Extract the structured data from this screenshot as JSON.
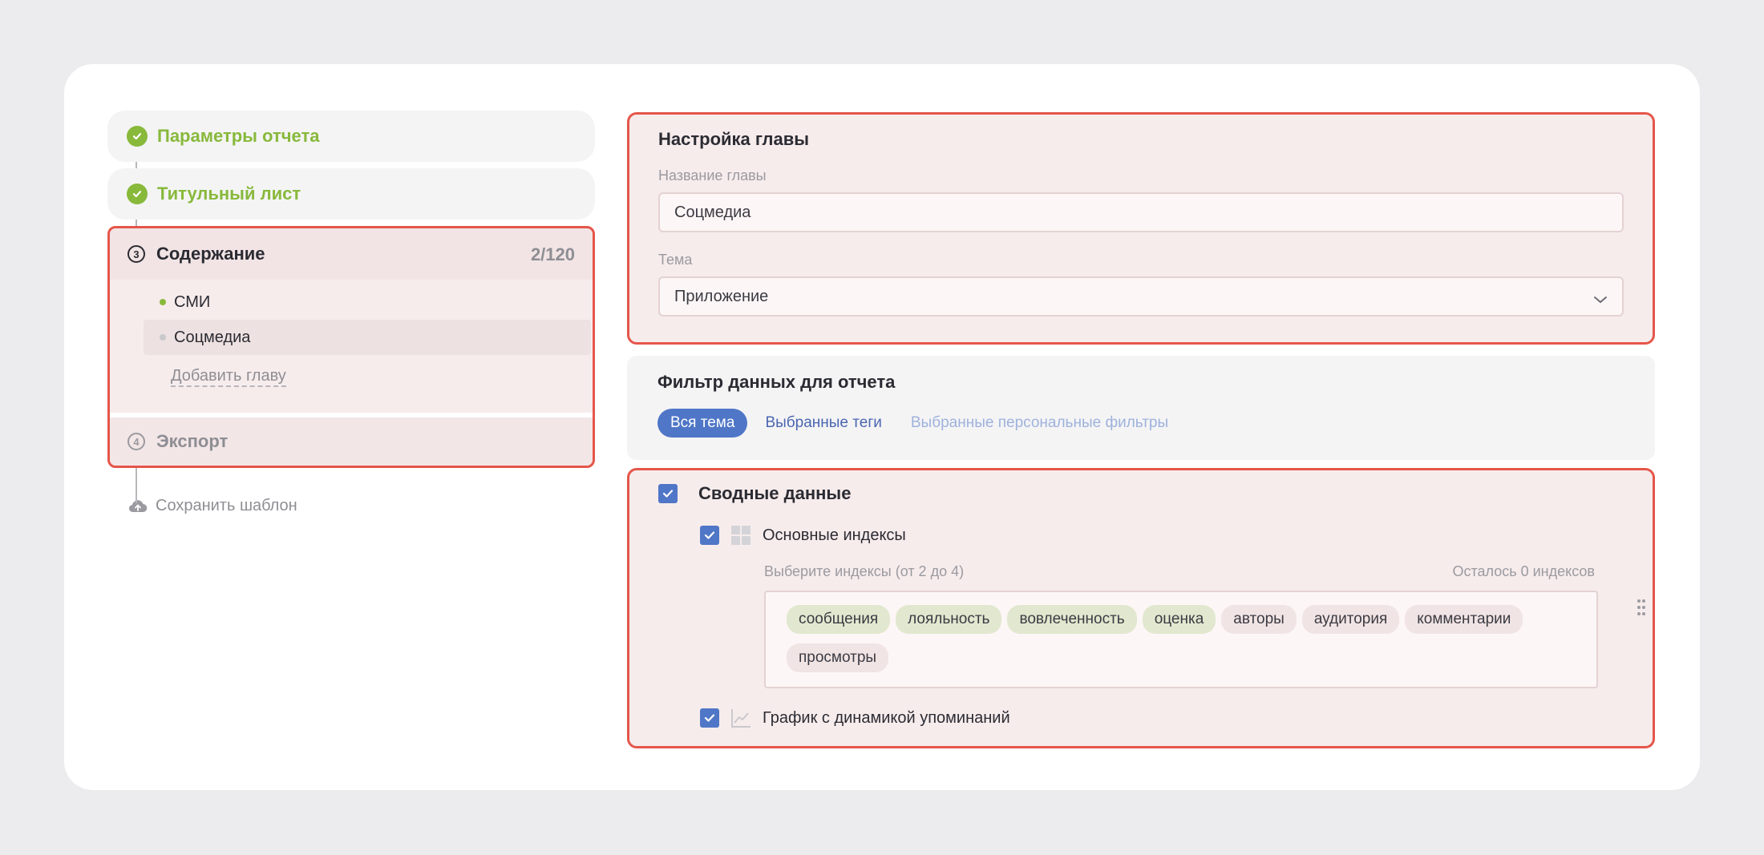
{
  "steps": {
    "params_title": "Параметры отчета",
    "title_page": "Титульный лист",
    "content": {
      "num": "3",
      "title": "Содержание",
      "count": "2/120"
    },
    "chapters": [
      {
        "label": "СМИ"
      },
      {
        "label": "Соцмедиа"
      }
    ],
    "add_chapter": "Добавить главу",
    "export": {
      "num": "4",
      "title": "Экспорт"
    }
  },
  "save_template": "Сохранить шаблон",
  "chapter_settings": {
    "title": "Настройка главы",
    "name_label": "Название главы",
    "name_value": "Соцмедиа",
    "theme_label": "Тема",
    "theme_value": "Приложение"
  },
  "filter": {
    "title": "Фильтр данных для отчета",
    "tabs": [
      "Вся тема",
      "Выбранные теги",
      "Выбранные персональные фильтры"
    ]
  },
  "summary": {
    "title": "Сводные данные",
    "main_indexes": "Основные индексы",
    "hint": "Выберите индексы (от 2 до 4)",
    "remaining": "Осталось 0 индексов",
    "chips": [
      {
        "label": "сообщения",
        "selected": true
      },
      {
        "label": "лояльность",
        "selected": true
      },
      {
        "label": "вовлеченность",
        "selected": true
      },
      {
        "label": "оценка",
        "selected": true
      },
      {
        "label": "авторы",
        "selected": false
      },
      {
        "label": "аудитория",
        "selected": false
      },
      {
        "label": "комментарии",
        "selected": false
      },
      {
        "label": "просмотры",
        "selected": false
      }
    ],
    "dynamics_chart": "График с динамикой упоминаний"
  },
  "colors": {
    "accent_green": "#88b93b",
    "accent_blue": "#4f76c7",
    "highlight_red": "#e5564a"
  }
}
